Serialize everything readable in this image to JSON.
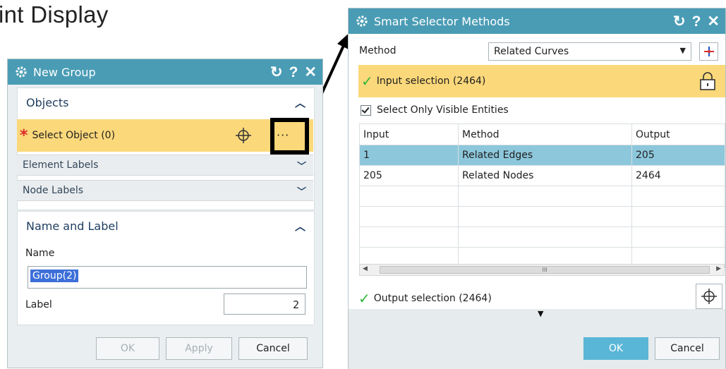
{
  "slide": {
    "title_fragment": "int Display"
  },
  "new_group": {
    "title": "New Group",
    "title_icons": {
      "reset": "↻",
      "help": "?",
      "close": "✕"
    },
    "objects": {
      "header": "Objects",
      "select_label": "Select Object (0)",
      "more_button": "···",
      "element_labels": "Element Labels",
      "node_labels": "Node Labels"
    },
    "name_and_label": {
      "header": "Name and Label",
      "name_label": "Name",
      "name_value": "Group(2)",
      "label_label": "Label",
      "label_value": "2"
    },
    "buttons": {
      "ok": "OK",
      "apply": "Apply",
      "cancel": "Cancel"
    }
  },
  "smart_selector": {
    "title": "Smart Selector Methods",
    "title_icons": {
      "reset": "↻",
      "help": "?",
      "close": "✕"
    },
    "method_label": "Method",
    "method_value": "Related Curves",
    "input_selection": "Input selection (2464)",
    "visible_only_label": "Select Only Visible Entities",
    "visible_only_checked": true,
    "table": {
      "headers": [
        "Input",
        "Method",
        "Output"
      ],
      "rows": [
        [
          "1",
          "Related Edges",
          "205"
        ],
        [
          "205",
          "Related Nodes",
          "2464"
        ],
        [
          "",
          "",
          ""
        ],
        [
          "",
          "",
          ""
        ],
        [
          "",
          "",
          ""
        ],
        [
          "",
          "",
          ""
        ]
      ],
      "selected_row": 0
    },
    "scroll_marker": "III",
    "output_selection": "Output selection (2464)",
    "buttons": {
      "ok": "OK",
      "cancel": "Cancel"
    }
  },
  "colors": {
    "titlebar": "#4a9cb5",
    "highlight_yellow": "#fbd87a",
    "selected_row": "#8dc7db",
    "ok_primary": "#5ab6d6"
  },
  "icons": [
    "gear-icon",
    "reset-icon",
    "help-icon",
    "close-icon",
    "crosshair-icon",
    "lock-icon",
    "check-icon",
    "chevron-down-icon",
    "chevron-up-icon",
    "arrow-icon"
  ]
}
